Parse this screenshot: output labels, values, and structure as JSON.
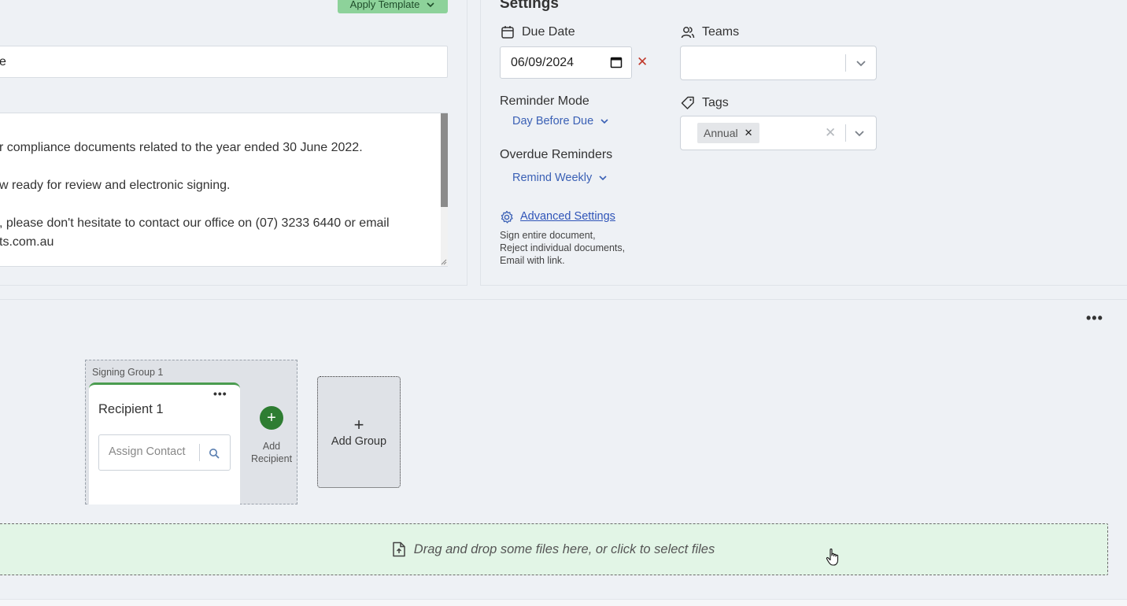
{
  "template": {
    "apply_label": "Apply Template"
  },
  "subject": {
    "value": "e"
  },
  "message": {
    "lines": [
      "r compliance documents related to the year ended 30 June 2022.",
      "w ready for review and electronic signing.",
      ", please don't hesitate to contact our office on (07) 3233 6440 or email",
      "ts.com.au"
    ]
  },
  "settings": {
    "title": "Settings",
    "due_date_label": "Due Date",
    "due_date_value": "06/09/2024",
    "clear_symbol": "✕",
    "teams_label": "Teams",
    "reminder_mode_label": "Reminder Mode",
    "reminder_mode_value": "Day Before Due",
    "overdue_label": "Overdue Reminders",
    "overdue_value": "Remind Weekly",
    "tags_label": "Tags",
    "tags": [
      "Annual"
    ],
    "advanced_label": "Advanced Settings",
    "advanced_desc": [
      "Sign entire document,",
      "Reject individual documents,",
      "Email with link."
    ]
  },
  "recipients": {
    "more_symbol": "•••",
    "group_label": "Signing Group 1",
    "recipient_title": "Recipient 1",
    "assign_placeholder": "Assign Contact",
    "add_recipient_label_1": "Add",
    "add_recipient_label_2": "Recipient",
    "add_group_label": "Add Group"
  },
  "dropzone": {
    "text": "Drag and drop some files here, or click to select files"
  },
  "colors": {
    "accent_green": "#2e7d32",
    "link_blue": "#2f54b8",
    "dropzone_bg": "#e2f5e6"
  }
}
